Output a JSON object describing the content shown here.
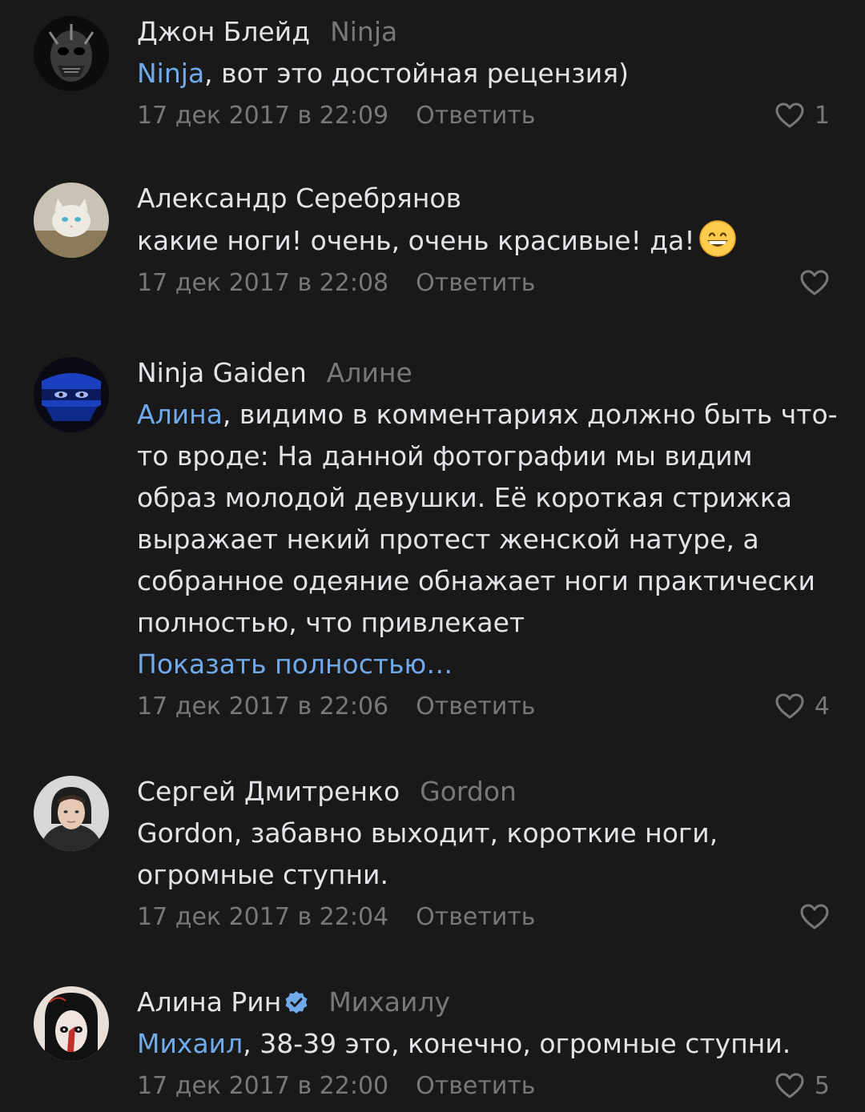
{
  "comments": [
    {
      "author": "Джон Блейд",
      "reply_to": "Ninja",
      "mention": "Ninja",
      "text": ", вот это достойная рецензия)",
      "date": "17 дек 2017 в 22:09",
      "reply_label": "Ответить",
      "likes": "1"
    },
    {
      "author": "Александр Серебрянов",
      "text": "какие ноги! очень, очень красивые! да!",
      "emoji": "grinning-face-emoji",
      "date": "17 дек 2017 в 22:08",
      "reply_label": "Ответить"
    },
    {
      "author": "Ninja Gaiden",
      "reply_to": "Алине",
      "mention": "Алина",
      "text": ", видимо в комментариях должно быть что-то вроде: На данной фотографии мы видим образ молодой девушки. Её короткая стрижка выражает некий протест женской натуре, а собранное одеяние обнажает ноги практически полностью, что привлекает",
      "show_more": "Показать полностью…",
      "date": "17 дек 2017 в 22:06",
      "reply_label": "Ответить",
      "likes": "4"
    },
    {
      "author": "Сергей Дмитренко",
      "reply_to": "Gordon",
      "text": "Gordon, забавно выходит, короткие ноги, огромные ступни.",
      "date": "17 дек 2017 в 22:04",
      "reply_label": "Ответить"
    },
    {
      "author": "Алина Рин",
      "verified_icon": "verified-check-icon",
      "reply_to": "Михаилу",
      "mention": "Михаил",
      "text": ", 38-39 это, конечно, огромные ступни.",
      "date": "17 дек 2017 в 22:00",
      "reply_label": "Ответить",
      "likes": "5"
    }
  ],
  "colors": {
    "background": "#19191a",
    "text": "#e1e3e6",
    "secondary": "#76787a",
    "link": "#71aaeb",
    "verified": "#71aaeb"
  }
}
